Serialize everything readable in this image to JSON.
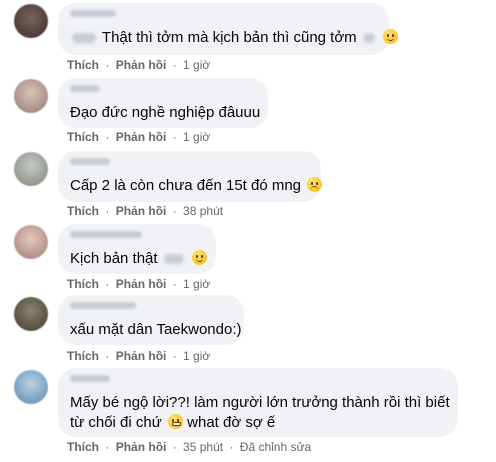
{
  "comments": [
    {
      "text": "Thật thì tởm mà kịch bản thì cũng tởm",
      "like": "Thích",
      "reply": "Phản hồi",
      "time": "1 giờ",
      "edited": "",
      "avatar_color": "#5a4542"
    },
    {
      "text": "Đạo đức nghề nghiệp đâuuu",
      "like": "Thích",
      "reply": "Phản hồi",
      "time": "1 giờ",
      "edited": "",
      "avatar_color": "#b9a39a"
    },
    {
      "text": "Cấp 2 là còn chưa đến 15t đó mng",
      "like": "Thích",
      "reply": "Phản hồi",
      "time": "38 phút",
      "edited": "",
      "avatar_color": "#a7aea5"
    },
    {
      "text": "Kịch bản thật",
      "like": "Thích",
      "reply": "Phản hồi",
      "time": "1 giờ",
      "edited": "",
      "avatar_color": "#c9a9a2"
    },
    {
      "text": "xấu mặt dân Taekwondo:)",
      "like": "Thích",
      "reply": "Phản hồi",
      "time": "1 giờ",
      "edited": "",
      "avatar_color": "#6b6553"
    },
    {
      "text_line1": "Mấy bé ngộ lời??! làm người lớn trưởng thành rồi thì biết",
      "text_line2": "từ chối đi chứ",
      "text_line2_end": "what đờ sợ ế",
      "like": "Thích",
      "reply": "Phản hồi",
      "time": "35 phút",
      "edited": "Đã chỉnh sửa",
      "avatar_color": "#8fb2cf"
    }
  ],
  "separator": "·"
}
